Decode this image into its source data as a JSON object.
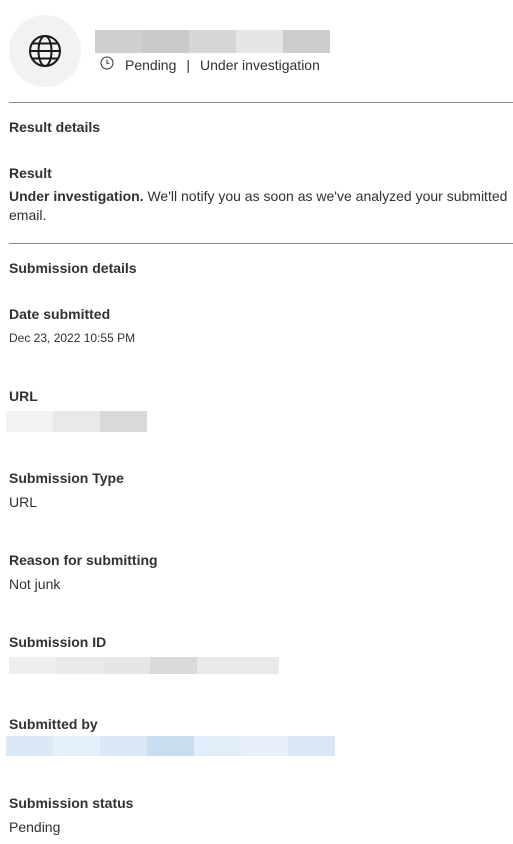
{
  "header": {
    "title_redacted": true,
    "status": "Pending",
    "separator": "|",
    "substatus": "Under investigation"
  },
  "result_details": {
    "section_title": "Result details",
    "result_label": "Result",
    "result_bold": "Under investigation.",
    "result_text": " We'll notify you as soon as we've analyzed your submitted email."
  },
  "submission_details": {
    "section_title": "Submission details",
    "date_label": "Date submitted",
    "date_value": "Dec 23, 2022 10:55 PM",
    "url_label": "URL",
    "type_label": "Submission Type",
    "type_value": "URL",
    "reason_label": "Reason for submitting",
    "reason_value": "Not junk",
    "id_label": "Submission ID",
    "submitted_by_label": "Submitted by",
    "status_label": "Submission status",
    "status_value": "Pending"
  },
  "icons": {
    "avatar": "globe-icon",
    "status": "clock-icon"
  }
}
